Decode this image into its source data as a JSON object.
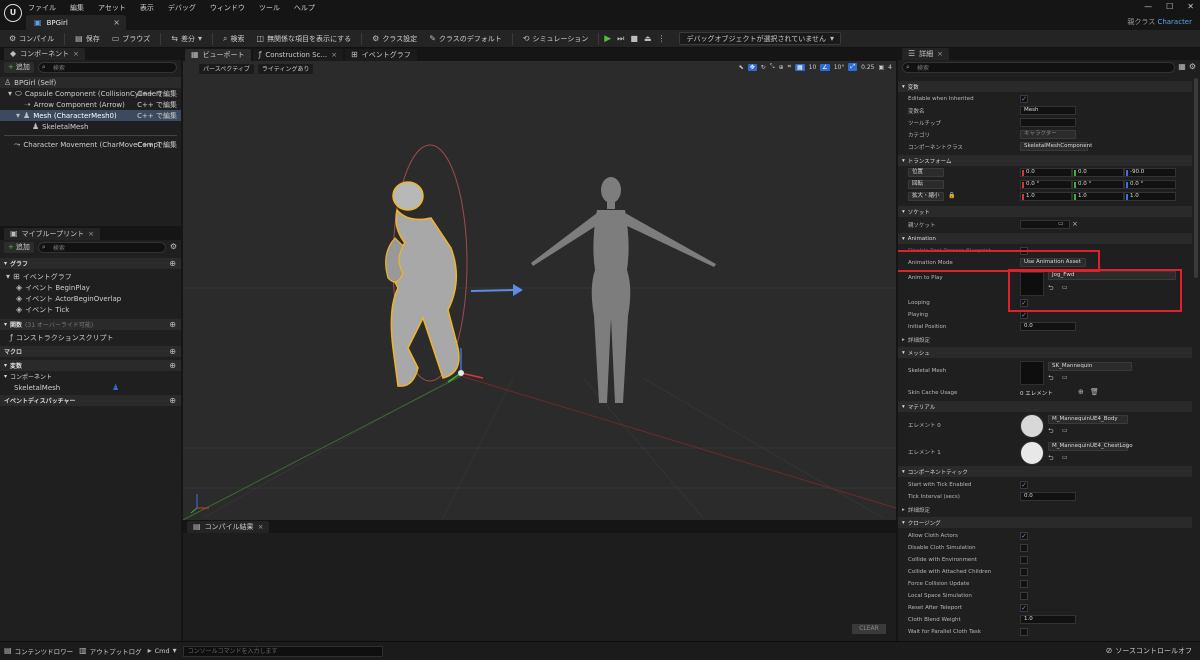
{
  "app": {
    "menu": [
      "ファイル",
      "編集",
      "アセット",
      "表示",
      "デバッグ",
      "ウィンドウ",
      "ツール",
      "ヘルプ"
    ],
    "document_tab": "BPGirl",
    "parent_class_label": "親クラス",
    "parent_class_value": "Character"
  },
  "toolbar": {
    "compile": "コンパイル",
    "save": "保存",
    "browse": "ブラウズ",
    "diff": "差分",
    "find": "検索",
    "hide_unrelated": "無関係な項目を表示にする",
    "class_settings": "クラス設定",
    "class_defaults": "クラスのデフォルト",
    "simulation": "シミュレーション",
    "debug_object": "デバッグオブジェクトが選択されていません"
  },
  "components": {
    "tab": "コンポーネント",
    "add": "追加",
    "search_placeholder": "検索",
    "items": [
      {
        "label": "BPGirl (Self)",
        "cpp": ""
      },
      {
        "label": "Capsule Component (CollisionCylinder)",
        "cpp": "C++ で編集"
      },
      {
        "label": "Arrow Component (Arrow)",
        "cpp": "C++ で編集"
      },
      {
        "label": "Mesh (CharacterMesh0)",
        "cpp": "C++ で編集"
      },
      {
        "label": "SkeletalMesh",
        "cpp": ""
      },
      {
        "label": "Character Movement (CharMoveComp)",
        "cpp": "C++ で編集"
      }
    ]
  },
  "myblueprint": {
    "tab": "マイブループリント",
    "add": "追加",
    "search_placeholder": "検索",
    "graphs_header": "グラフ",
    "event_graph": "イベントグラフ",
    "events": [
      "イベント BeginPlay",
      "イベント ActorBeginOverlap",
      "イベント Tick"
    ],
    "functions_header": "関数",
    "functions_note": "(31 オーバーライド可能)",
    "construction_script": "コンストラクションスクリプト",
    "macros_header": "マクロ",
    "variables_header": "変数",
    "components_sub": "コンポーネント",
    "var_item": "SkeletalMesh",
    "dispatchers_header": "イベントディスパッチャー"
  },
  "viewport": {
    "tabs": [
      "ビューポート",
      "Construction Sc...",
      "イベントグラフ"
    ],
    "perspective": "パースペクティブ",
    "lighting": "ライティングあり",
    "grid_snap": "10",
    "rot_snap": "10°",
    "scale_snap": "0.25",
    "cam_speed": "4"
  },
  "compile_results": {
    "tab": "コンパイル結果",
    "clear": "CLEAR"
  },
  "details": {
    "tab": "詳細",
    "search_placeholder": "検索",
    "variable_header": "変数",
    "editable_label": "Editable when Inherited",
    "var_name_label": "変数名",
    "var_name_value": "Mesh",
    "tooltip_label": "ツールチップ",
    "category_label": "カテゴリ",
    "category_value": "キャラクター",
    "component_class_label": "コンポーネントクラス",
    "component_class_value": "SkeletalMeshComponent",
    "transform_header": "トランスフォーム",
    "location_label": "位置",
    "rotation_label": "回転",
    "scale_label": "拡大・縮小",
    "location": [
      "0.0",
      "0.0",
      "-90.0"
    ],
    "rotation": [
      "0.0 °",
      "0.0 °",
      "0.0 °"
    ],
    "scale": [
      "1.0",
      "1.0",
      "1.0"
    ],
    "sockets_header": "ソケット",
    "parent_socket_label": "親ソケット",
    "animation_header": "Animation",
    "anim_blueprint_label": "Disable Post Process Blueprint",
    "anim_mode_label": "Animation Mode",
    "anim_mode_value": "Use Animation Asset",
    "anim_to_play_label": "Anim to Play",
    "anim_to_play_value": "Jog_Fwd",
    "looping_label": "Looping",
    "playing_label": "Playing",
    "initial_position_label": "Initial Position",
    "initial_position_value": "0.0",
    "advanced": "詳細設定",
    "mesh_header": "メッシュ",
    "skeletal_mesh_label": "Skeletal Mesh",
    "skeletal_mesh_value": "SK_Mannequin",
    "skin_cache_label": "Skin Cache Usage",
    "skin_cache_value": "0 エレメント",
    "materials_header": "マテリアル",
    "element0_label": "エレメント 0",
    "element0_value": "M_MannequinUE4_Body",
    "element1_label": "エレメント 1",
    "element1_value": "M_MannequinUE4_ChestLogo",
    "tick_header": "コンポーネントティック",
    "start_tick_label": "Start with Tick Enabled",
    "tick_interval_label": "Tick Interval (secs)",
    "tick_interval_value": "0.0",
    "advanced2": "詳細設定",
    "clothing_header": "クロージング",
    "cloth_rows": [
      {
        "label": "Allow Cloth Actors",
        "checked": true
      },
      {
        "label": "Disable Cloth Simulation",
        "checked": false
      },
      {
        "label": "Collide with Environment",
        "checked": false
      },
      {
        "label": "Collide with Attached Children",
        "checked": false
      },
      {
        "label": "Force Collision Update",
        "checked": false
      },
      {
        "label": "Local Space Simulation",
        "checked": false
      },
      {
        "label": "Reset After Teleport",
        "checked": true
      }
    ],
    "cloth_blend_label": "Cloth Blend Weight",
    "cloth_blend_value": "1.0",
    "wait_parallel_label": "Wait for Parallel Cloth Task"
  },
  "statusbar": {
    "content_drawer": "コンテンツドロワー",
    "output_log": "アウトプットログ",
    "cmd": "Cmd",
    "cmd_placeholder": "コンソールコマンドを入力します",
    "source_control": "ソースコントロールオフ"
  },
  "colors": {
    "accent": "#2f6bd4",
    "highlight": "#e0202a",
    "play": "#4fbf3a",
    "selection": "#f0b429"
  }
}
